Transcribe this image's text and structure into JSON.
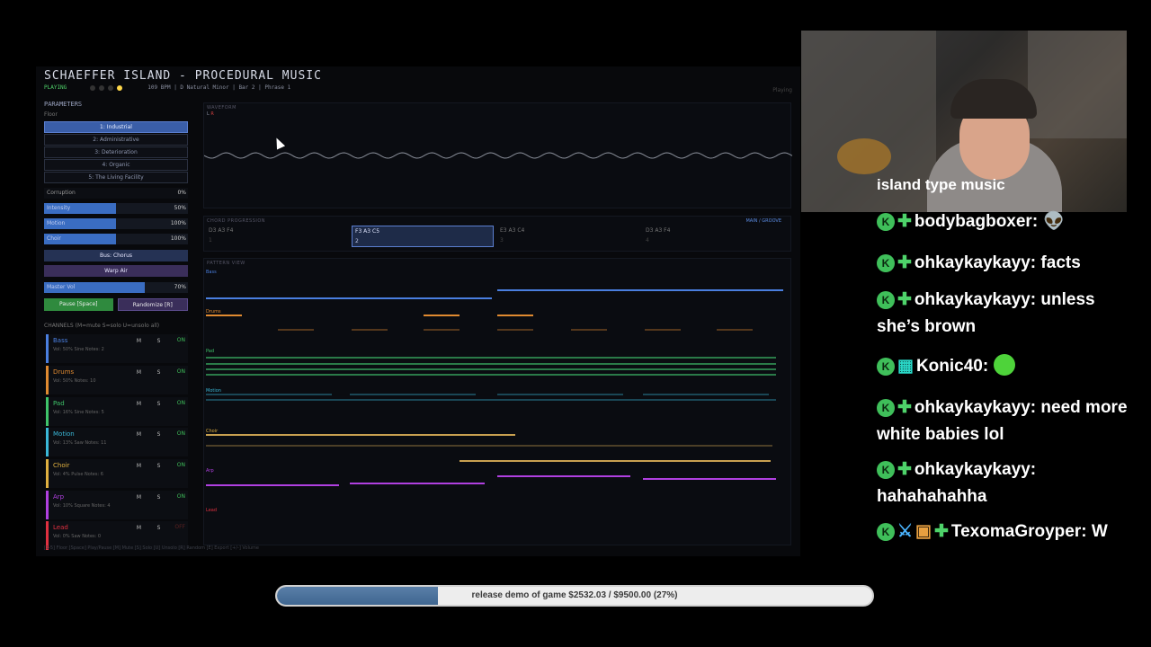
{
  "app": {
    "title": "SCHAEFFER ISLAND - PROCEDURAL MUSIC",
    "status": "PLAYING",
    "info": "109 BPM  |  D Natural Minor  |  Bar 2  |  Phrase 1",
    "right_status": "Playing"
  },
  "params": {
    "title": "PARAMETERS",
    "floor_label": "Floor",
    "floors": [
      "1: Industrial",
      "2: Administrative",
      "3: Deterioration",
      "4: Organic",
      "5: The Living Facility"
    ],
    "active_floor": 0,
    "sliders": [
      {
        "label": "Corruption",
        "value": "0%",
        "fraction": 0.0
      },
      {
        "label": "Intensity",
        "value": "50%",
        "fraction": 0.5
      },
      {
        "label": "Motion",
        "value": "100%",
        "fraction": 0.5
      },
      {
        "label": "Choir",
        "value": "100%",
        "fraction": 0.5
      }
    ],
    "bus_chorus": "Bus: Chorus",
    "warp_air": "Warp Air",
    "master_volume": {
      "label": "Master Vol",
      "value": "70%",
      "fraction": 0.7
    },
    "pause_button": "Pause [Space]",
    "randomize_button": "Randomize [R]"
  },
  "channels_label": "CHANNELS  (M=mute  S=solo  U=unsolo all)",
  "channels": [
    {
      "name": "Bass",
      "info": "Vol: 50%  Sine  Notes: 2",
      "color": "#4a7fe0",
      "on": "ON"
    },
    {
      "name": "Drums",
      "info": "Vol: 50%  Notes: 10",
      "color": "#e08a30",
      "on": "ON"
    },
    {
      "name": "Pad",
      "info": "Vol: 16%  Sine  Notes: 5",
      "color": "#3fc46a",
      "on": "ON"
    },
    {
      "name": "Motion",
      "info": "Vol: 13%  Saw  Notes: 11",
      "color": "#3ab8d8",
      "on": "ON"
    },
    {
      "name": "Choir",
      "info": "Vol: 4%  Pulse  Notes: 6",
      "color": "#e0b040",
      "on": "ON"
    },
    {
      "name": "Arp",
      "info": "Vol: 10%  Square  Notes: 4",
      "color": "#b040e0",
      "on": "ON"
    },
    {
      "name": "Lead",
      "info": "Vol: 0%  Saw  Notes: 0",
      "color": "#e03040",
      "on": "OFF"
    }
  ],
  "channel_buttons": {
    "mute": "M",
    "solo": "S"
  },
  "help_line": "[1-5] Floor  [Space] Play/Pause  [M] Mute  [S] Solo  [U] Unsolo  [R] Random  [E] Export  [+/-] Volume",
  "waveform": {
    "title": "WAVEFORM",
    "left": "L",
    "right": "R"
  },
  "chords": {
    "title": "CHORD PROGRESSION",
    "mode": "MAIN / GROOVE",
    "items": [
      {
        "notes": "D3 A3 F4",
        "index": "1"
      },
      {
        "notes": "F3 A3 C5",
        "index": "2"
      },
      {
        "notes": "E3 A3 C4",
        "index": "3"
      },
      {
        "notes": "D3 A3 F4",
        "index": "4"
      }
    ],
    "active": 1
  },
  "pattern": {
    "title": "PATTERN VIEW",
    "tracks": [
      "Bass",
      "Drums",
      "Pad",
      "Motion",
      "Choir",
      "Arp",
      "Lead"
    ]
  },
  "webcam_caption": "island type music",
  "chat": [
    {
      "user": "bodybagboxer:",
      "text": "",
      "emote": "alien"
    },
    {
      "user": "ohkaykaykayy:",
      "text": "facts"
    },
    {
      "user": "ohkaykaykayy:",
      "text": "unless she’s brown"
    },
    {
      "user": "Konic40:",
      "text": "",
      "emote": "green-face"
    },
    {
      "user": "ohkaykaykayy:",
      "text": "need more white babies lol"
    },
    {
      "user": "ohkaykaykayy:",
      "text": "hahahahahha"
    },
    {
      "user": "TexomaGroyper:",
      "text": "W"
    }
  ],
  "goal": {
    "text": "release demo of game $2532.03 / $9500.00 (27%)",
    "fraction": 0.27,
    "color": "#4a72a0"
  },
  "colors": {
    "accent": "#3a5ea8",
    "playing": "#4fd36a",
    "chat_badge": "#3fbf5a"
  }
}
